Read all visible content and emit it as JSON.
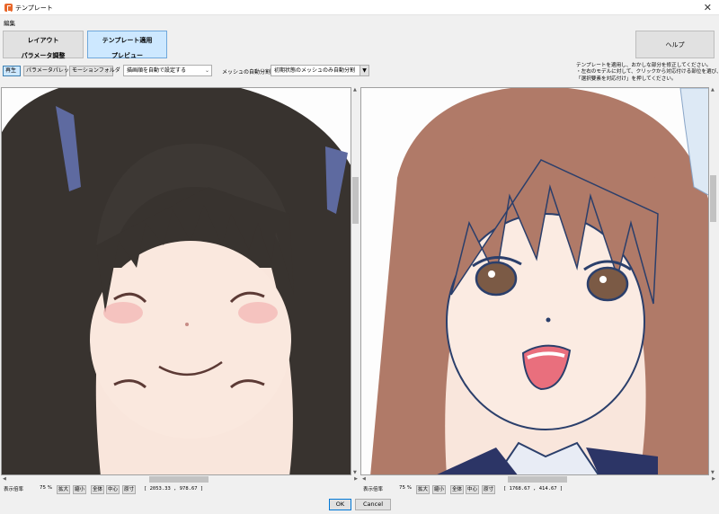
{
  "window": {
    "title": "テンプレート",
    "close_glyph": "✕"
  },
  "menu": {
    "edit": "編集"
  },
  "steps": [
    {
      "line1": "レイアウト",
      "line2": "パラメータ調整"
    },
    {
      "line1": "テンプレート適用",
      "line2": "プレビュー"
    }
  ],
  "help_label": "ヘルプ",
  "instructions": [
    "テンプレートを適用し、おかしな部分を修正してください。",
    "・左右のモデルに対して、クリックから対応付ける部位を選び、",
    "「選択要素を対応付け」を押してください。"
  ],
  "toolbar": {
    "play": "再生",
    "param_palette": "パラメータパレット",
    "motion_folder": "モーションフォルダ",
    "draw_order_select": "描画順を自動で設定する",
    "mesh_label": "メッシュの自動分割",
    "mesh_select": "初期状態のメッシュのみ自動分割"
  },
  "left_status": {
    "zoom_label": "表示倍率",
    "zoom_value": "75 %",
    "zoom_in": "拡大",
    "zoom_out": "縮小",
    "fit": "全体",
    "center": "中心",
    "actual": "原寸",
    "coords": "[ 2053.33 , 978.67 ]"
  },
  "right_status": {
    "zoom_label": "表示倍率",
    "zoom_value": "75 %",
    "zoom_in": "拡大",
    "zoom_out": "縮小",
    "fit": "全体",
    "center": "中心",
    "actual": "原寸",
    "coords": "[ 1768.67 , 414.67 ]"
  },
  "footer": {
    "ok": "OK",
    "cancel": "Cancel"
  },
  "colors": {
    "accent": "#0078d7",
    "active_tab": "#cde8ff",
    "left_hair": "#38332f",
    "right_hair": "#b07a68",
    "skin": "#f9e6dc",
    "outline": "#2b3f6b"
  },
  "icons": {
    "app": "cubism-app-icon",
    "close": "close-icon",
    "dropdown": "chevron-down-icon"
  }
}
